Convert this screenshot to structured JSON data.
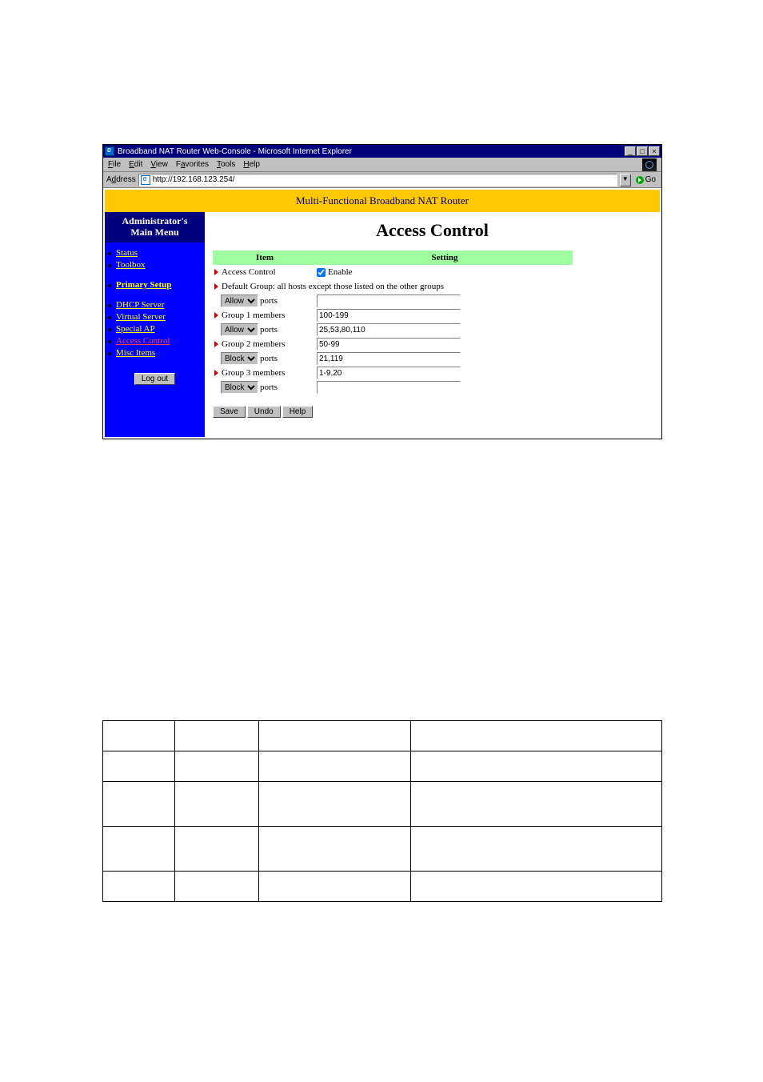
{
  "window": {
    "title": "Broadband NAT Router Web-Console - Microsoft Internet Explorer",
    "sys": {
      "min": "_",
      "max": "□",
      "close": "×"
    }
  },
  "menubar": {
    "file": "File",
    "edit": "Edit",
    "view": "View",
    "favorites": "Favorites",
    "tools": "Tools",
    "help": "Help"
  },
  "addressbar": {
    "label": "Address",
    "url": "http://192.168.123.254/",
    "go": "Go"
  },
  "banner": "Multi-Functional Broadband NAT Router",
  "sidebar": {
    "title_line1": "Administrator's",
    "title_line2": "Main Menu",
    "items": {
      "status": "Status",
      "toolbox": "Toolbox",
      "primary_setup": "Primary Setup",
      "dhcp_server": "DHCP Server",
      "virtual_server": "Virtual Server",
      "special_ap": "Special AP",
      "access_control": "Access Control",
      "misc_items": "Misc Items"
    },
    "logout": "Log out"
  },
  "main": {
    "heading": "Access Control",
    "headers": {
      "item": "Item",
      "setting": "Setting"
    },
    "rows": {
      "access_control_label": "Access Control",
      "enable_label": "Enable",
      "enable_checked": true,
      "default_group_label": "Default Group: all hosts except those listed on the other groups",
      "ports_word": "ports",
      "default_action": "Allow",
      "default_ports": "",
      "group1_label": "Group 1 members",
      "group1_members": "100-199",
      "group1_action": "Allow",
      "group1_ports": "25,53,80,110",
      "group2_label": "Group 2 members",
      "group2_members": "50-99",
      "group2_action": "Block",
      "group2_ports": "21,119",
      "group3_label": "Group 3 members",
      "group3_members": "1-9,20",
      "group3_action": "Block",
      "group3_ports": ""
    },
    "select_options": {
      "allow": "Allow",
      "block": "Block"
    },
    "buttons": {
      "save": "Save",
      "undo": "Undo",
      "help": "Help"
    }
  }
}
